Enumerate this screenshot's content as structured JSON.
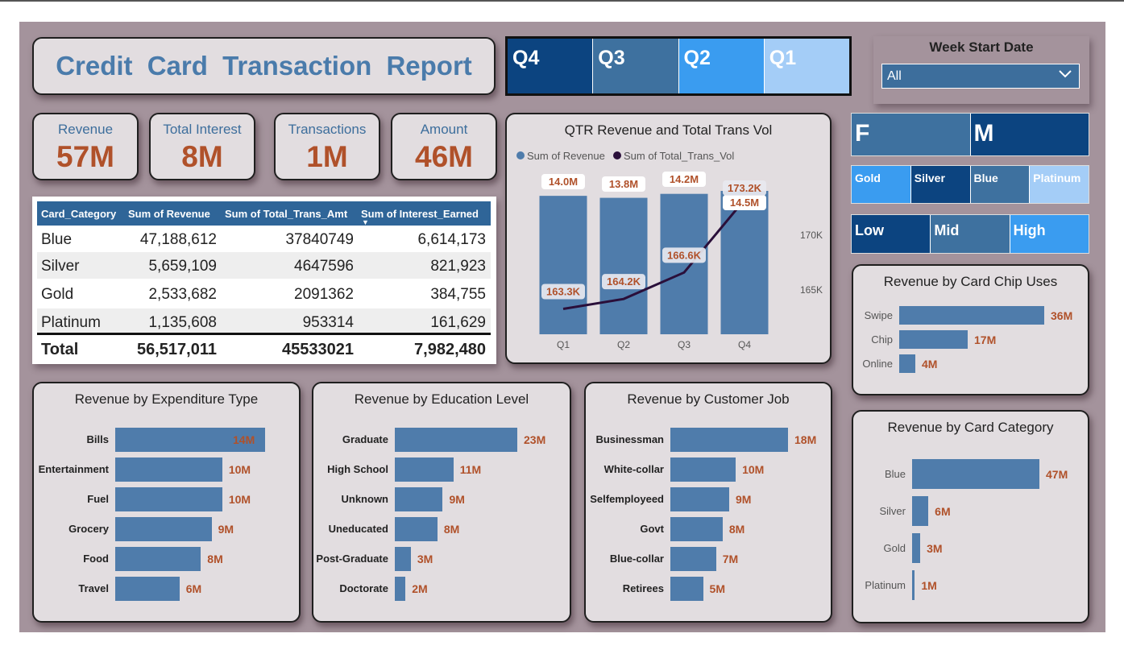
{
  "report": {
    "title": "Credit Card Transaction Report"
  },
  "quarter_slicer": {
    "items": [
      {
        "label": "Q4",
        "color": "#0c4480"
      },
      {
        "label": "Q3",
        "color": "#3e719f"
      },
      {
        "label": "Q2",
        "color": "#3a9cf0"
      },
      {
        "label": "Q1",
        "color": "#a4cdf7"
      }
    ]
  },
  "week_filter": {
    "label": "Week Start Date",
    "value": "All"
  },
  "kpis": [
    {
      "label": "Revenue",
      "value": "57M"
    },
    {
      "label": "Total Interest",
      "value": "8M"
    },
    {
      "label": "Transactions",
      "value": "1M"
    },
    {
      "label": "Amount",
      "value": "46M"
    }
  ],
  "table": {
    "headers": [
      "Card_Category",
      "Sum of Revenue",
      "Sum of Total_Trans_Amt",
      "Sum of Interest_Earned"
    ],
    "rows": [
      [
        "Blue",
        "47,188,612",
        "37840749",
        "6,614,173"
      ],
      [
        "Silver",
        "5,659,109",
        "4647596",
        "821,923"
      ],
      [
        "Gold",
        "2,533,682",
        "2091362",
        "384,755"
      ],
      [
        "Platinum",
        "1,135,608",
        "953314",
        "161,629"
      ]
    ],
    "total": [
      "Total",
      "56,517,011",
      "45533021",
      "7,982,480"
    ]
  },
  "gender_slicer": [
    {
      "label": "F",
      "color": "#3e719f"
    },
    {
      "label": "M",
      "color": "#0c4480"
    }
  ],
  "category_slicer": [
    {
      "label": "Gold",
      "color": "#3a9cf0"
    },
    {
      "label": "Silver",
      "color": "#0c4480"
    },
    {
      "label": "Blue",
      "color": "#3e719f"
    },
    {
      "label": "Platinum",
      "color": "#a4cdf7"
    }
  ],
  "income_slicer": [
    {
      "label": "Low",
      "color": "#0c4480"
    },
    {
      "label": "Mid",
      "color": "#3e719f"
    },
    {
      "label": "High",
      "color": "#3a9cf0"
    }
  ],
  "colors": {
    "bar": "#4f7cab",
    "line": "#2a0f3a",
    "value_label": "#b0512a",
    "kpi_label": "#3d6e9c"
  },
  "chart_data": [
    {
      "type": "bar+line",
      "title": "QTR Revenue and Total Trans Vol",
      "legend": [
        "Sum of Revenue",
        "Sum of Total_Trans_Vol"
      ],
      "legend_position": "top-left",
      "categories": [
        "Q1",
        "Q2",
        "Q3",
        "Q4"
      ],
      "series": [
        {
          "name": "Sum of Revenue",
          "type": "bar",
          "values": [
            14.0,
            13.8,
            14.2,
            14.5
          ],
          "labels": [
            "14.0M",
            "13.8M",
            "14.2M",
            "14.5M"
          ]
        },
        {
          "name": "Sum of Total_Trans_Vol",
          "type": "line",
          "values": [
            163.3,
            164.2,
            166.6,
            173.2
          ],
          "labels": [
            "163.3K",
            "164.2K",
            "166.6K",
            "173.2K"
          ]
        }
      ],
      "y2_ticks": [
        "170K",
        "165K"
      ],
      "y2_tick_values": [
        170,
        165
      ],
      "y2lim": [
        161,
        174
      ],
      "ylim": [
        0,
        14.5
      ]
    },
    {
      "type": "bar",
      "orientation": "horizontal",
      "title": "Revenue by Card Chip Uses",
      "categories": [
        "Swipe",
        "Chip",
        "Online"
      ],
      "values": [
        36,
        17,
        4
      ],
      "labels": [
        "36M",
        "17M",
        "4M"
      ]
    },
    {
      "type": "bar",
      "orientation": "horizontal",
      "title": "Revenue by Expenditure Type",
      "categories": [
        "Bills",
        "Entertainment",
        "Fuel",
        "Grocery",
        "Food",
        "Travel"
      ],
      "values": [
        14,
        10,
        10,
        9,
        8,
        6
      ],
      "labels": [
        "14M",
        "10M",
        "10M",
        "9M",
        "8M",
        "6M"
      ]
    },
    {
      "type": "bar",
      "orientation": "horizontal",
      "title": "Revenue by Education Level",
      "categories": [
        "Graduate",
        "High School",
        "Unknown",
        "Uneducated",
        "Post-Graduate",
        "Doctorate"
      ],
      "values": [
        23,
        11,
        9,
        8,
        3,
        2
      ],
      "labels": [
        "23M",
        "11M",
        "9M",
        "8M",
        "3M",
        "2M"
      ]
    },
    {
      "type": "bar",
      "orientation": "horizontal",
      "title": "Revenue by Customer Job",
      "categories": [
        "Businessman",
        "White-collar",
        "Selfemployeed",
        "Govt",
        "Blue-collar",
        "Retirees"
      ],
      "values": [
        18,
        10,
        9,
        8,
        7,
        5
      ],
      "labels": [
        "18M",
        "10M",
        "9M",
        "8M",
        "7M",
        "5M"
      ]
    },
    {
      "type": "bar",
      "orientation": "horizontal",
      "title": "Revenue by Card Category",
      "categories": [
        "Blue",
        "Silver",
        "Gold",
        "Platinum"
      ],
      "values": [
        47,
        6,
        3,
        1
      ],
      "labels": [
        "47M",
        "6M",
        "3M",
        "1M"
      ]
    }
  ]
}
